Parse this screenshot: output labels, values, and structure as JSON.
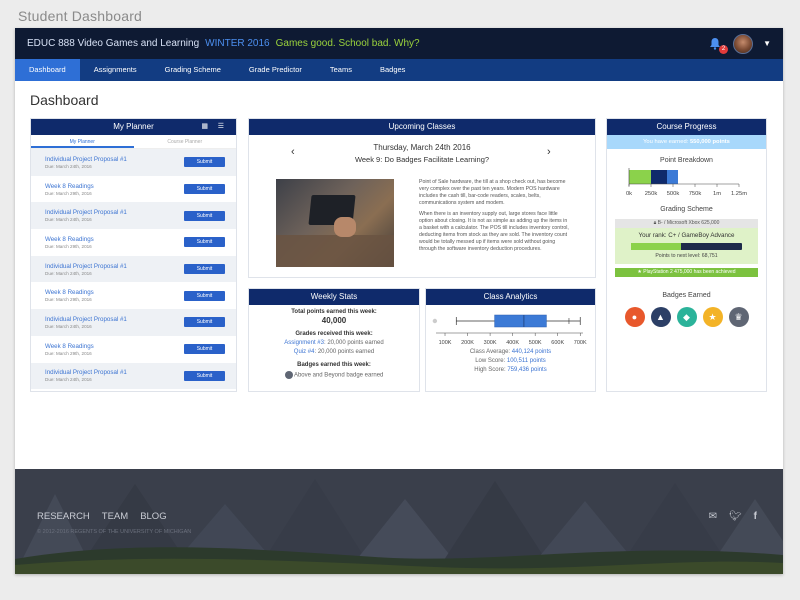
{
  "page_caption": "Student Dashboard",
  "topbar": {
    "course": "EDUC 888 Video Games and Learning",
    "term": "WINTER 2016",
    "tagline": "Games good. School bad. Why?",
    "notification_count": "2"
  },
  "nav": [
    "Dashboard",
    "Assignments",
    "Grading Scheme",
    "Grade Predictor",
    "Teams",
    "Badges"
  ],
  "page_title": "Dashboard",
  "planner": {
    "title": "My Planner",
    "tabs": [
      "My Planner",
      "Course Planner"
    ],
    "items": [
      {
        "title": "Individual Project Proposal #1",
        "due": "Due: March 24th, 2016",
        "button": "Submit"
      },
      {
        "title": "Week 8 Readings",
        "due": "Due: March 29th, 2016",
        "button": "Submit"
      },
      {
        "title": "Individual Project Proposal #1",
        "due": "Due: March 24th, 2016",
        "button": "Submit"
      },
      {
        "title": "Week 8 Readings",
        "due": "Due: March 29th, 2016",
        "button": "Submit"
      },
      {
        "title": "Individual Project Proposal #1",
        "due": "Due: March 24th, 2016",
        "button": "Submit"
      },
      {
        "title": "Week 8 Readings",
        "due": "Due: March 29th, 2016",
        "button": "Submit"
      },
      {
        "title": "Individual Project Proposal #1",
        "due": "Due: March 24th, 2016",
        "button": "Submit"
      },
      {
        "title": "Week 8 Readings",
        "due": "Due: March 29th, 2016",
        "button": "Submit"
      },
      {
        "title": "Individual Project Proposal #1",
        "due": "Due: March 24th, 2016",
        "button": "Submit"
      }
    ]
  },
  "upcoming": {
    "title": "Upcoming Classes",
    "date": "Thursday, March 24th 2016",
    "class_title": "Week 9: Do Badges Facilitate Learning?",
    "body_1": "Point of Sale hardware, the till at a shop check out, has become very complex over the past ten years. Modern POS hardware includes the cash till, bar-code readers, scales, belts, communications system and modem.",
    "body_2": "When there is an inventory supply out, large stores face little option about closing. It is not as simple as adding up the items in a basket with a calculator. The POS till includes inventory control, deducting items from stock as they are sold. The inventory count would be totally messed up if items were sold without going through the software inventory deduction procedures."
  },
  "weekly": {
    "title": "Weekly Stats",
    "total_label": "Total points earned this week:",
    "total_value": "40,000",
    "grades_label": "Grades received this week:",
    "grades": [
      {
        "name": "Assignment #3",
        "text": ": 20,000 points earned"
      },
      {
        "name": "Quiz #4",
        "text": ": 20,000 points earned"
      }
    ],
    "badges_label": "Badges earned this week:",
    "badge_text": "Above and Beyond badge earned"
  },
  "analytics": {
    "title": "Class Analytics",
    "avg_label": "Class Average:",
    "avg_value": "440,124 points",
    "low_label": "Low Score:",
    "low_value": "100,511 points",
    "high_label": "High Score:",
    "high_value": "759,436 points"
  },
  "chart_data": {
    "type": "boxplot",
    "ticks": [
      "100K",
      "200K",
      "300K",
      "400K",
      "500K",
      "600K",
      "700K"
    ],
    "xlim": [
      60000,
      730000
    ],
    "outlier": 55000,
    "whisker_low": 150000,
    "q1": 320000,
    "median": 450000,
    "q3": 550000,
    "whisker_high": 700000,
    "marker": 650000
  },
  "progress": {
    "title": "Course Progress",
    "earned_prefix": "You have earned:",
    "earned_value": "550,000 points",
    "breakdown_title": "Point Breakdown",
    "breakdown_ticks": [
      "0k",
      "250k",
      "500k",
      "750k",
      "1m",
      "1.25m"
    ],
    "scheme_title": "Grading Scheme",
    "prev_level": "B- / Microsoft Xbox 625,000",
    "rank": "Your rank: C+ / GameBoy Advance",
    "next_level": "Points to next level: 68,751",
    "rank_fraction": 0.45,
    "achieved": "PlayStation 2 475,000 has been achieved",
    "badges_title": "Badges Earned",
    "badge_colors": [
      "#e8582c",
      "#2c3f66",
      "#2bb39a",
      "#f3b327",
      "#5f6674"
    ]
  },
  "footer": {
    "links": [
      "RESEARCH",
      "TEAM",
      "BLOG"
    ],
    "copyright": "© 2012-2016 REGENTS OF THE UNIVERSITY OF MICHIGAN"
  }
}
